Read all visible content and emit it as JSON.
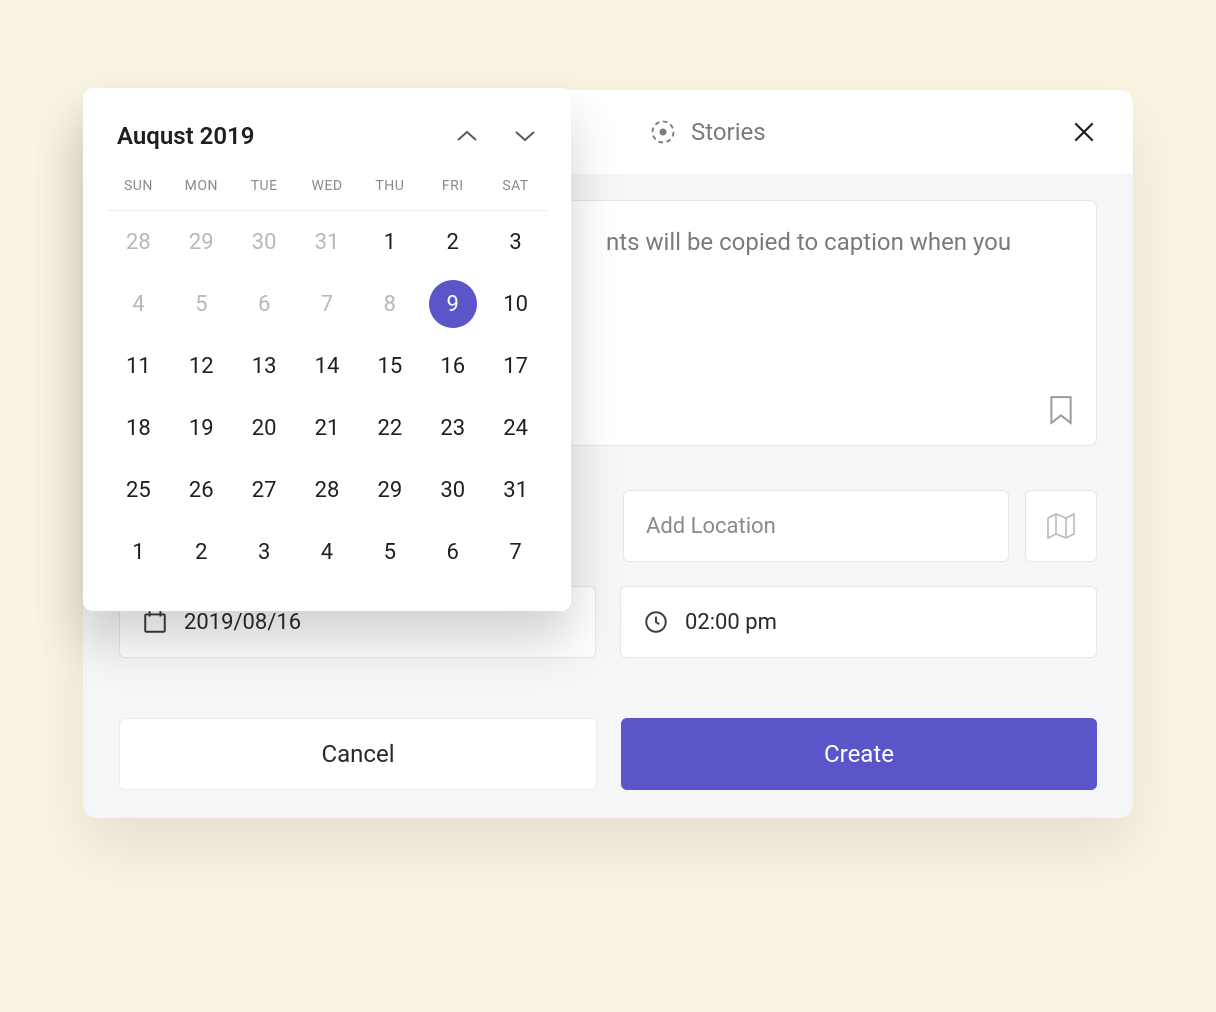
{
  "header": {
    "stories_label": "Stories"
  },
  "caption": {
    "visible_text": "nts will be copied to caption when you"
  },
  "location": {
    "placeholder": "Add Location"
  },
  "date_field": {
    "value": "2019/08/16"
  },
  "time_field": {
    "value": "02:00 pm"
  },
  "buttons": {
    "cancel": "Cancel",
    "create": "Create"
  },
  "calendar": {
    "title": "Auqust 2019",
    "dow": [
      "SUN",
      "MON",
      "TUE",
      "WED",
      "THU",
      "FRI",
      "SAT"
    ],
    "cells": [
      {
        "d": "28",
        "muted": true
      },
      {
        "d": "29",
        "muted": true
      },
      {
        "d": "30",
        "muted": true
      },
      {
        "d": "31",
        "muted": true
      },
      {
        "d": "1"
      },
      {
        "d": "2"
      },
      {
        "d": "3"
      },
      {
        "d": "4",
        "muted": true
      },
      {
        "d": "5",
        "muted": true
      },
      {
        "d": "6",
        "muted": true
      },
      {
        "d": "7",
        "muted": true
      },
      {
        "d": "8",
        "muted": true
      },
      {
        "d": "9",
        "selected": true
      },
      {
        "d": "10"
      },
      {
        "d": "11"
      },
      {
        "d": "12"
      },
      {
        "d": "13"
      },
      {
        "d": "14"
      },
      {
        "d": "15"
      },
      {
        "d": "16"
      },
      {
        "d": "17"
      },
      {
        "d": "18"
      },
      {
        "d": "19"
      },
      {
        "d": "20"
      },
      {
        "d": "21"
      },
      {
        "d": "22"
      },
      {
        "d": "23"
      },
      {
        "d": "24"
      },
      {
        "d": "25"
      },
      {
        "d": "26"
      },
      {
        "d": "27"
      },
      {
        "d": "28"
      },
      {
        "d": "29"
      },
      {
        "d": "30"
      },
      {
        "d": "31"
      },
      {
        "d": "1"
      },
      {
        "d": "2"
      },
      {
        "d": "3"
      },
      {
        "d": "4"
      },
      {
        "d": "5"
      },
      {
        "d": "6"
      },
      {
        "d": "7"
      }
    ]
  },
  "colors": {
    "accent": "#5a55c9",
    "bg": "#f9f3e2"
  }
}
